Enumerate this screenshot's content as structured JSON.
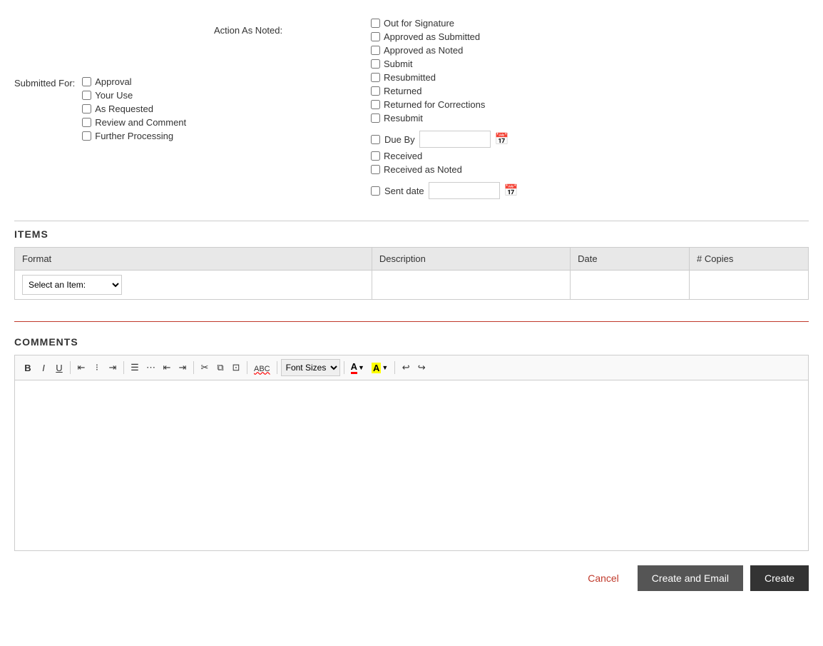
{
  "submitted_for": {
    "label": "Submitted For:",
    "checkboxes": [
      {
        "id": "cb-approval",
        "label": "Approval"
      },
      {
        "id": "cb-your-use",
        "label": "Your Use"
      },
      {
        "id": "cb-as-requested",
        "label": "As Requested"
      },
      {
        "id": "cb-review-comment",
        "label": "Review and Comment"
      },
      {
        "id": "cb-further-processing",
        "label": "Further Processing"
      }
    ]
  },
  "action_as_noted": {
    "label": "Action As Noted:"
  },
  "right_checkboxes": [
    {
      "id": "rcb-out-signature",
      "label": "Out for Signature"
    },
    {
      "id": "rcb-approved-submitted",
      "label": "Approved as Submitted"
    },
    {
      "id": "rcb-approved-noted",
      "label": "Approved as Noted"
    },
    {
      "id": "rcb-submit",
      "label": "Submit"
    },
    {
      "id": "rcb-resubmitted",
      "label": "Resubmitted"
    },
    {
      "id": "rcb-returned",
      "label": "Returned"
    },
    {
      "id": "rcb-returned-corrections",
      "label": "Returned for Corrections"
    },
    {
      "id": "rcb-resubmit",
      "label": "Resubmit"
    }
  ],
  "due_by": {
    "label": "Due By",
    "value": ""
  },
  "received_checkboxes": [
    {
      "id": "rcb-received",
      "label": "Received"
    },
    {
      "id": "rcb-received-noted",
      "label": "Received as Noted"
    }
  ],
  "sent_date": {
    "label": "Sent date",
    "value": ""
  },
  "items_section": {
    "title": "ITEMS",
    "columns": [
      "Format",
      "Description",
      "Date",
      "# Copies"
    ],
    "select_placeholder": "Select an Item:"
  },
  "comments_section": {
    "title": "COMMENTS",
    "toolbar": {
      "bold": "B",
      "italic": "I",
      "underline": "U",
      "align_left": "≡",
      "align_center": "≡",
      "align_right": "≡",
      "bullet_list": "≡",
      "numbered_list": "≡",
      "indent_decrease": "≡",
      "indent_increase": "≡",
      "cut": "✂",
      "copy": "⧉",
      "paste": "📋",
      "spellcheck": "ABC",
      "font_sizes_label": "Font Sizes",
      "font_color": "A",
      "highlight_color": "A",
      "undo": "↩",
      "redo": "↪"
    }
  },
  "footer": {
    "cancel_label": "Cancel",
    "create_email_label": "Create and Email",
    "create_label": "Create"
  }
}
